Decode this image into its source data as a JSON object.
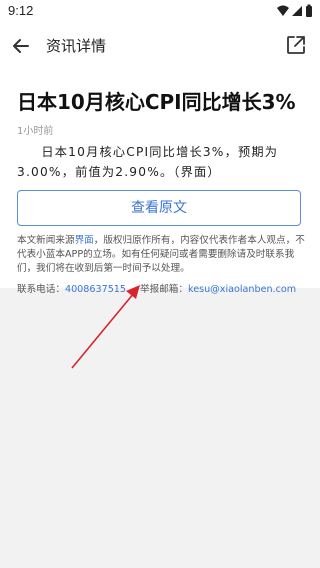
{
  "status_bar": {
    "time": "9:12"
  },
  "navbar": {
    "title": "资讯详情"
  },
  "article": {
    "headline": "日本10月核心CPI同比增长3%",
    "time_ago": "1小时前",
    "body": "日本10月核心CPI同比增长3%，预期为3.00%，前值为2.90%。（界面）"
  },
  "original_button": {
    "label": "查看原文"
  },
  "disclaimer": {
    "part1": "本文新闻来源",
    "source_link": "界面",
    "part2": "，版权归原作所有，内容仅代表作者本人观点，不代表小蓝本APP的立场。如有任何疑问或者需要删除请及时联系我们，我们将在收到后第一时间予以处理。"
  },
  "contact": {
    "phone_label": "联系电话：",
    "phone": "4008637515",
    "email_label": "举报邮箱：",
    "email": "kesu@xiaolanben.com"
  },
  "colors": {
    "accent": "#3a74d8",
    "annotation_arrow": "#d9252a"
  }
}
